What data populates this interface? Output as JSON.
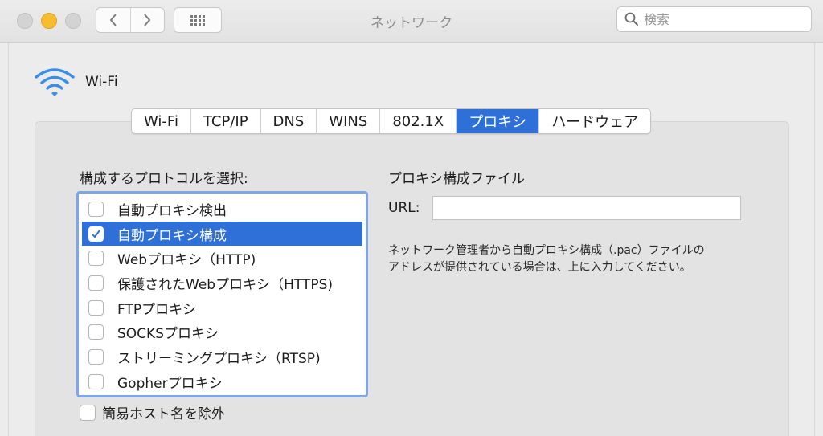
{
  "window": {
    "title": "ネットワーク",
    "search_placeholder": "検索"
  },
  "service": {
    "name": "Wi-Fi",
    "icon": "wifi-icon"
  },
  "tabs": [
    {
      "label": "Wi-Fi",
      "active": false
    },
    {
      "label": "TCP/IP",
      "active": false
    },
    {
      "label": "DNS",
      "active": false
    },
    {
      "label": "WINS",
      "active": false
    },
    {
      "label": "802.1X",
      "active": false
    },
    {
      "label": "プロキシ",
      "active": true
    },
    {
      "label": "ハードウェア",
      "active": false
    }
  ],
  "proxy": {
    "protocol_label": "構成するプロトコルを選択:",
    "protocols": [
      {
        "label": "自動プロキシ検出",
        "checked": false,
        "selected": false
      },
      {
        "label": "自動プロキシ構成",
        "checked": true,
        "selected": true
      },
      {
        "label": "Webプロキシ（HTTP)",
        "checked": false,
        "selected": false
      },
      {
        "label": "保護されたWebプロキシ（HTTPS)",
        "checked": false,
        "selected": false
      },
      {
        "label": "FTPプロキシ",
        "checked": false,
        "selected": false
      },
      {
        "label": "SOCKSプロキシ",
        "checked": false,
        "selected": false
      },
      {
        "label": "ストリーミングプロキシ（RTSP)",
        "checked": false,
        "selected": false
      },
      {
        "label": "Gopherプロキシ",
        "checked": false,
        "selected": false
      }
    ],
    "exclude_simple_hosts": "簡易ホスト名を除外",
    "pac_title": "プロキシ構成ファイル",
    "url_label": "URL:",
    "url_value": "",
    "help_line1": "ネットワーク管理者から自動プロキシ構成（.pac）ファイルの",
    "help_line2": "アドレスが提供されている場合は、上に入力してください。"
  },
  "colors": {
    "accent": "#2f6fd8",
    "wifi": "#3b8ee8",
    "minimize": "#f7bd2e"
  }
}
